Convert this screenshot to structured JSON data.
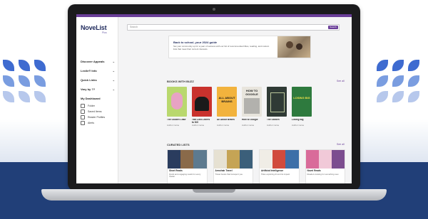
{
  "window": {
    "language_label": "English"
  },
  "app": {
    "logo_text": "NoveList",
    "logo_plus": "Plus",
    "sidebar": {
      "menu": [
        {
          "label": "Discover Appeals",
          "icon": "chevron-down-icon"
        },
        {
          "label": "Lexile® Info",
          "icon": "chevron-down-icon"
        },
        {
          "label": "Quick Links",
          "icon": "chevron-down-icon"
        },
        {
          "label": "Vary by ??",
          "icon": "chevron-down-icon"
        }
      ],
      "dashboard_title": "My Dashboard",
      "dashboard_items": [
        "Folder",
        "Saved Items",
        "Reader Profiles",
        "Alerts"
      ]
    },
    "search": {
      "placeholder": "Search",
      "button_label": "Search"
    },
    "banner": {
      "title": "Back to school, your 2024 guide",
      "text": "Set your community up for a year of success with our list of recommended titles, reading, and custom lists that meet their current interests."
    },
    "books_section": {
      "title": "BOOKS WITH BUZZ",
      "see_all": "See all",
      "books": [
        {
          "title": "The Golden Chair",
          "author": "Author name",
          "cover_color": "#b9d86e",
          "cover_text": ""
        },
        {
          "title": "Two Lost Lovers to Kill",
          "author": "Author name",
          "cover_color": "#c9322d",
          "cover_text": ""
        },
        {
          "title": "All About Brains",
          "author": "Author name",
          "cover_color": "#f2b33d",
          "cover_text": "ALL ABOUT BRAINS"
        },
        {
          "title": "How to Google",
          "author": "Author name",
          "cover_color": "#e8e5dd",
          "cover_text": "HOW TO GOOGLE"
        },
        {
          "title": "The Garden",
          "author": "Author name",
          "cover_color": "#2f3a35",
          "cover_text": ""
        },
        {
          "title": "Losing Big",
          "author": "Author name",
          "cover_color": "#2e7a3e",
          "cover_text": "LOSING BIG"
        }
      ]
    },
    "lists_section": {
      "title": "CURATED LISTS",
      "see_all": "See all",
      "lists": [
        {
          "title": "Short Reads",
          "subtitle": "Books & more",
          "description": "Quick and engaging reads for every reader.",
          "colors": [
            "#2a3c5e",
            "#8a6a4a",
            "#5d7a8f"
          ]
        },
        {
          "title": "Armchair Travel",
          "subtitle": "",
          "description": "Travel books that transport you.",
          "colors": [
            "#e6e1d2",
            "#c5a455",
            "#3b5f7a"
          ]
        },
        {
          "title": "Artificial Intelligence",
          "subtitle": "",
          "description": "Titles exploring AI and its impact.",
          "colors": [
            "#f0ede6",
            "#d14b3d",
            "#3d6fa8"
          ]
        },
        {
          "title": "Novel Reads",
          "subtitle": "",
          "description": "Readers looking for something new.",
          "colors": [
            "#d96b9a",
            "#f1c9d8",
            "#7c4d8f"
          ]
        }
      ]
    }
  },
  "colors": {
    "accent": "#6a3e98",
    "brand_navy": "#1f2a5c",
    "background_navy": "#213f78",
    "leaf_blue": "#3e6bd0"
  }
}
